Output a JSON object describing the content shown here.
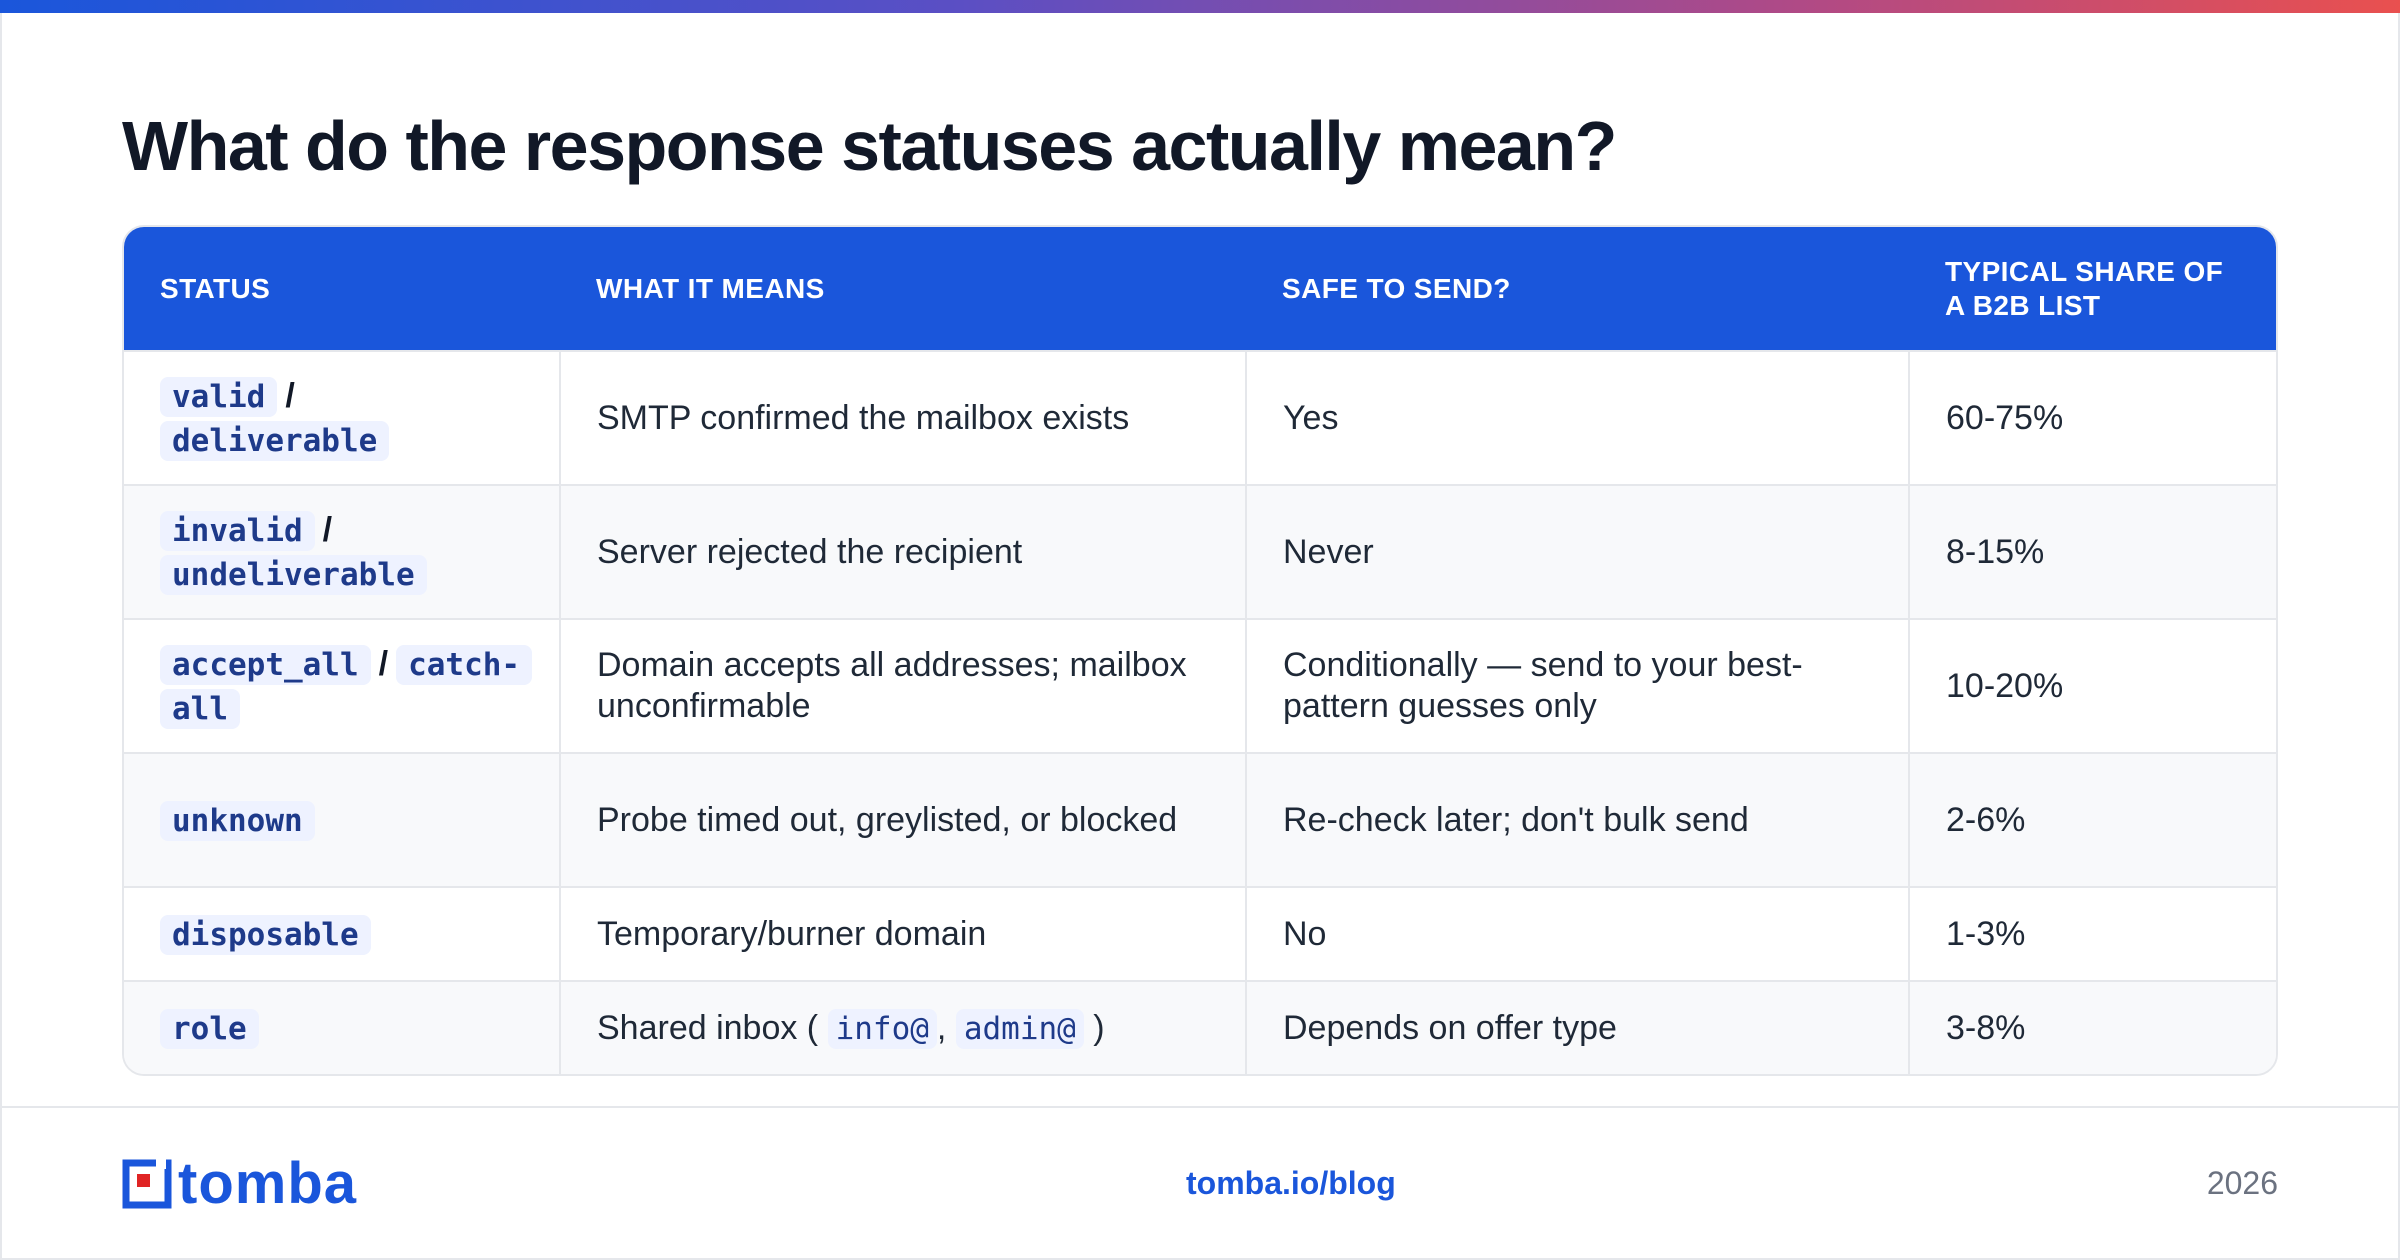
{
  "title": "What do the response statuses actually mean?",
  "table": {
    "headers": [
      "STATUS",
      "WHAT IT MEANS",
      "SAFE TO SEND?",
      "TYPICAL SHARE OF A B2B LIST"
    ],
    "rows": [
      {
        "status_a": "valid",
        "sep": "/",
        "status_b": "deliverable",
        "meaning": "SMTP confirmed the mailbox exists",
        "safe": "Yes",
        "share": "60-75%"
      },
      {
        "status_a": "invalid",
        "sep": "/",
        "status_b": "undeliverable",
        "meaning": "Server rejected the recipient",
        "safe": "Never",
        "share": "8-15%"
      },
      {
        "status_a": "accept_all",
        "sep": "/",
        "status_b": "catch-all",
        "meaning": "Domain accepts all addresses; mailbox unconfirmable",
        "safe": "Conditionally — send to your best-pattern guesses only",
        "share": "10-20%"
      },
      {
        "status_a": "unknown",
        "meaning": "Probe timed out, greylisted, or blocked",
        "safe": "Re-check later; don't bulk send",
        "share": "2-6%"
      },
      {
        "status_a": "disposable",
        "meaning": "Temporary/burner domain",
        "safe": "No",
        "share": "1-3%"
      },
      {
        "status_a": "role",
        "meaning_prefix": "Shared inbox (",
        "code_1": "info@",
        "comma": ",",
        "code_2": "admin@",
        "meaning_suffix": ")",
        "safe": "Depends on offer type",
        "share": "3-8%"
      }
    ]
  },
  "footer": {
    "logo_text": "tomba",
    "link": "tomba.io/blog",
    "year": "2026"
  },
  "colors": {
    "accent": "#1a56db",
    "code_bg": "#eef2ff",
    "code_text": "#1e3a8a",
    "logo_red": "#e02424"
  }
}
